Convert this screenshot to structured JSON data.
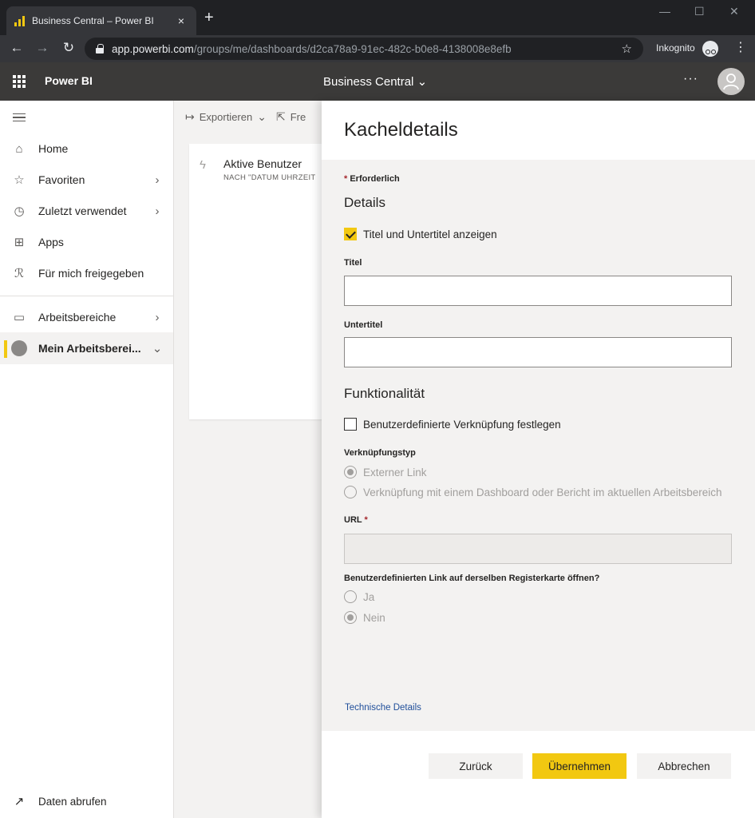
{
  "browser": {
    "tab_title": "Business Central – Power BI",
    "tab_close": "×",
    "new_tab": "+",
    "window_controls": [
      "—",
      "☐",
      "✕"
    ],
    "url_host": "app.powerbi.com",
    "url_path": "/groups/me/dashboards/d2ca78a9-91ec-482c-b0e8-4138008e8efb",
    "incognito_label": "Inkognito",
    "nav_icons": [
      "back-arrow-icon",
      "forward-arrow-icon",
      "reload-icon"
    ]
  },
  "header": {
    "app_name": "Power BI",
    "workspace_title": "Business Central",
    "more_icon": "···"
  },
  "leftnav": {
    "items": [
      {
        "icon": "home-icon",
        "glyph": "⌂",
        "label": "Home",
        "chevron": ""
      },
      {
        "icon": "star-icon",
        "glyph": "☆",
        "label": "Favoriten",
        "chevron": "›"
      },
      {
        "icon": "clock-icon",
        "glyph": "◷",
        "label": "Zuletzt verwendet",
        "chevron": "›"
      },
      {
        "icon": "apps-icon",
        "glyph": "⊞",
        "label": "Apps",
        "chevron": ""
      },
      {
        "icon": "shared-icon",
        "glyph": "ℛ",
        "label": "Für mich freigegeben",
        "chevron": ""
      },
      {
        "icon": "workspaces-icon",
        "glyph": "▭",
        "label": "Arbeitsbereiche",
        "chevron": "›"
      },
      {
        "icon": "my-workspace-icon",
        "glyph": "",
        "label": "Mein Arbeitsberei...",
        "chevron": "⌄"
      }
    ],
    "get_data": "Daten abrufen"
  },
  "toolbar": {
    "export_label": "Exportieren",
    "share_label": "Fre"
  },
  "tile": {
    "title": "Aktive Benutzer",
    "subtitle": "NACH \"DATUM UHRZEIT"
  },
  "pane": {
    "title": "Kacheldetails",
    "required_note": "Erforderlich",
    "required_star": "*",
    "details_heading": "Details",
    "show_title_checkbox": "Titel und Untertitel anzeigen",
    "title_label": "Titel",
    "title_value": "",
    "subtitle_label": "Untertitel",
    "subtitle_value": "",
    "functionality_heading": "Funktionalität",
    "custom_link_checkbox": "Benutzerdefinierte Verknüpfung festlegen",
    "link_type_label": "Verknüpfungstyp",
    "link_type_options": [
      "Externer Link",
      "Verknüpfung mit einem Dashboard oder Bericht im aktuellen Arbeitsbereich"
    ],
    "url_label": "URL",
    "same_tab_label": "Benutzerdefinierten Link auf derselben Registerkarte öffnen?",
    "same_tab_options": [
      "Ja",
      "Nein"
    ],
    "tech_details": "Technische Details",
    "buttons": {
      "back": "Zurück",
      "apply": "Übernehmen",
      "cancel": "Abbrechen"
    }
  }
}
